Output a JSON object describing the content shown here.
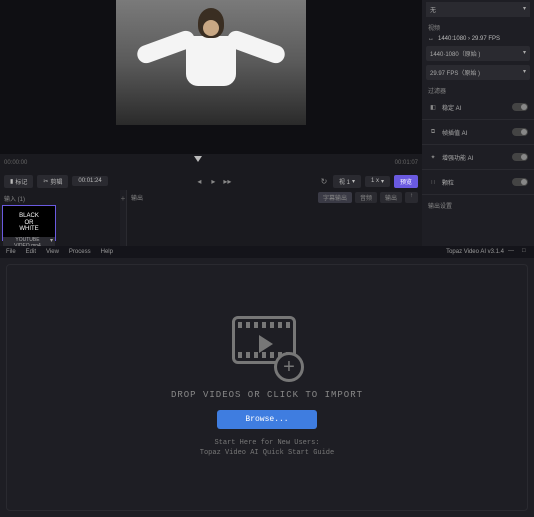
{
  "top": {
    "timeline": {
      "start": "00:00:00",
      "end": "00:01:07"
    },
    "controls": {
      "mark": "标记",
      "trim": "剪辑",
      "duration": "00:01:24",
      "view": "视 1",
      "scale": "1 x",
      "preview": "预览"
    },
    "inputs": {
      "header": "输入 (1)",
      "thumb_title": "BLACK\nOR\nWHITE",
      "thumb_file": "YOUTUBE VIDEO.mp4"
    },
    "output": {
      "header": "输出",
      "chip_preview": "字幕输出",
      "chip_audio": "音频",
      "chip_meta": "输出"
    }
  },
  "right": {
    "top_select": "无",
    "section_video": "视频",
    "res_line": "1440:1080 › 29.97 FPS",
    "res_box": "1440·1080（原始   )",
    "fps_box": "29.97 FPS（原始   )",
    "section_filters": "过滤器",
    "rows": [
      {
        "icon": "stabilize",
        "label": "稳定 AI"
      },
      {
        "icon": "framerate",
        "label": "帧插值 AI"
      },
      {
        "icon": "enhance",
        "label": "增强功能 AI"
      },
      {
        "icon": "grain",
        "label": "颗粒"
      }
    ],
    "section_output": "输出设置"
  },
  "menubar": {
    "items": [
      "File",
      "Edit",
      "View",
      "Process",
      "Help"
    ],
    "app": "Topaz Video AI  v3.1.4"
  },
  "bottom": {
    "drop": "DROP VIDEOS OR CLICK TO IMPORT",
    "browse": "Browse...",
    "guide1": "Start Here for New Users:",
    "guide2": "Topaz Video AI Quick Start Guide"
  }
}
